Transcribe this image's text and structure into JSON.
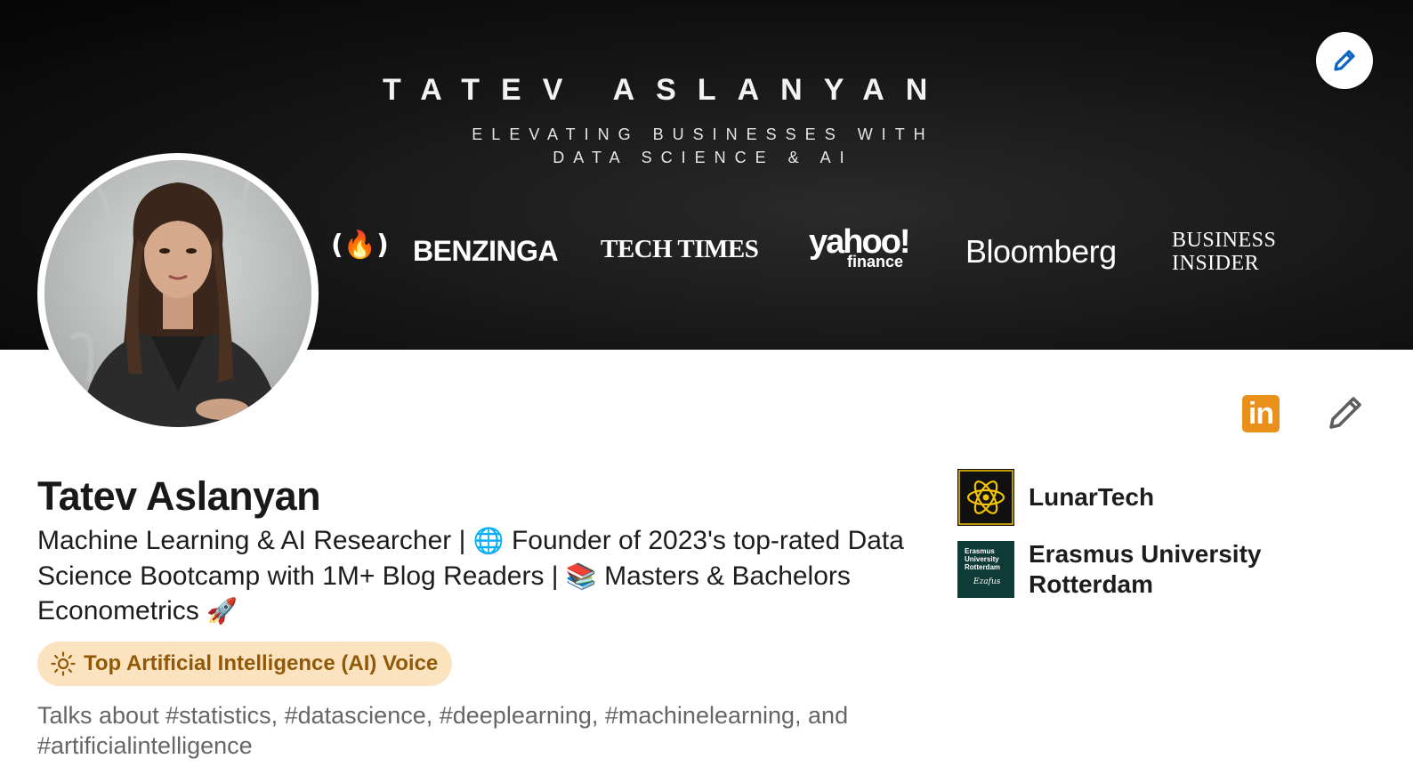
{
  "cover": {
    "title": "TATEV ASLANYAN",
    "subtitle_line1": "ELEVATING BUSINESSES WITH",
    "subtitle_line2": "DATA SCIENCE & AI",
    "media_logos": [
      {
        "label": "(🔥)",
        "name": "freecodecamp"
      },
      {
        "label": "BENZINGA",
        "name": "benzinga"
      },
      {
        "label": "TECH TIMES",
        "name": "tech-times"
      },
      {
        "label": "yahoo!",
        "sub": "finance",
        "name": "yahoo-finance"
      },
      {
        "label": "Bloomberg",
        "name": "bloomberg"
      },
      {
        "label_line1": "BUSINESS",
        "label_line2": "INSIDER",
        "name": "business-insider"
      }
    ],
    "edit_icon": "pencil-icon"
  },
  "profile": {
    "name": "Tatev Aslanyan",
    "headline": {
      "part1": "Machine Learning & AI Researcher | ",
      "globe": "🌐",
      "part2": " Founder of 2023's top-rated Data Science Bootcamp with 1M+ Blog Readers | ",
      "books": "📚",
      "part3": "  Masters & Bachelors Econometrics ",
      "rocket": "🚀"
    },
    "voice_badge": "Top Artificial Intelligence (AI) Voice",
    "voice_icon": "sun-icon",
    "talks_about": "Talks about #statistics, #datascience, #deeplearning, #machinelearning, and #artificialintelligence"
  },
  "actions": {
    "linkedin_label": "in",
    "edit_icon": "pencil-icon"
  },
  "organizations": [
    {
      "name": "LunarTech",
      "logo": "atom-icon"
    },
    {
      "name": "Erasmus University Rotterdam",
      "logo_text_line1": "Erasmus",
      "logo_text_line2": "University",
      "logo_text_line3": "Rotterdam",
      "logo_signature": "Ezafus"
    }
  ],
  "colors": {
    "badge_bg": "#fce3bf",
    "badge_text": "#915907",
    "linkedin_orange": "#e8901a",
    "edit_blue": "#0a66c2",
    "lunar_bg": "#111111",
    "lunar_accent": "#f5c400",
    "erasmus_bg": "#0f3b36"
  }
}
